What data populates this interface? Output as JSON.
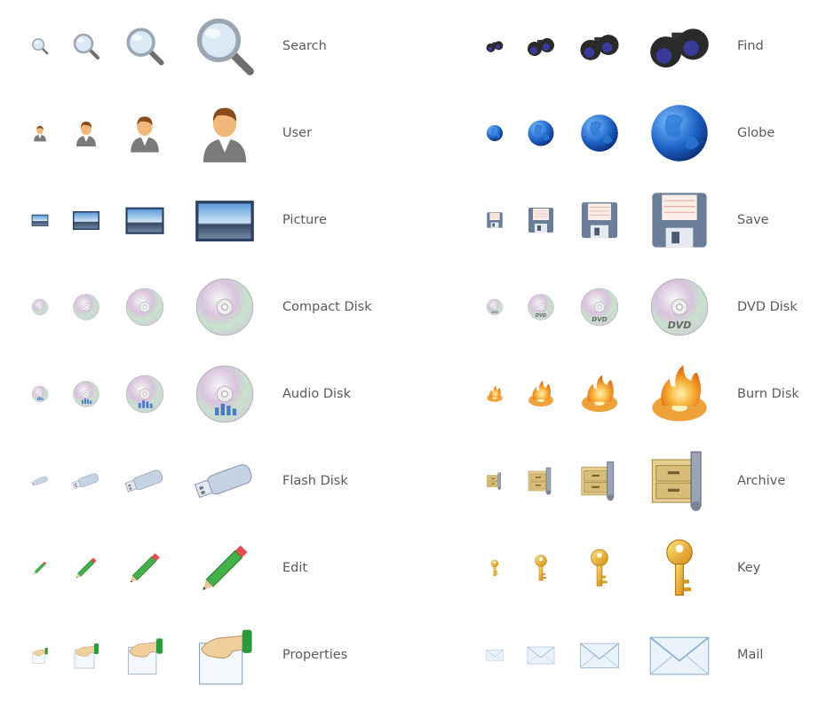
{
  "icon_sizes": [
    "small",
    "medium",
    "large",
    "extra-large"
  ],
  "columns": [
    {
      "items": [
        {
          "label": "Search",
          "icon": "search-icon"
        },
        {
          "label": "User",
          "icon": "user-icon"
        },
        {
          "label": "Picture",
          "icon": "picture-icon"
        },
        {
          "label": "Compact Disk",
          "icon": "compact-disk-icon"
        },
        {
          "label": "Audio Disk",
          "icon": "audio-disk-icon"
        },
        {
          "label": "Flash Disk",
          "icon": "flash-disk-icon"
        },
        {
          "label": "Edit",
          "icon": "edit-pencil-icon"
        },
        {
          "label": "Properties",
          "icon": "properties-icon"
        }
      ]
    },
    {
      "items": [
        {
          "label": "Find",
          "icon": "find-binoculars-icon"
        },
        {
          "label": "Globe",
          "icon": "globe-icon"
        },
        {
          "label": "Save",
          "icon": "save-floppy-icon"
        },
        {
          "label": "DVD Disk",
          "icon": "dvd-disk-icon"
        },
        {
          "label": "Burn Disk",
          "icon": "burn-disk-icon"
        },
        {
          "label": "Archive",
          "icon": "archive-icon"
        },
        {
          "label": "Key",
          "icon": "key-icon"
        },
        {
          "label": "Mail",
          "icon": "mail-icon"
        }
      ]
    }
  ],
  "colors": {
    "label": "#5a5a5a",
    "background": "#ffffff"
  }
}
